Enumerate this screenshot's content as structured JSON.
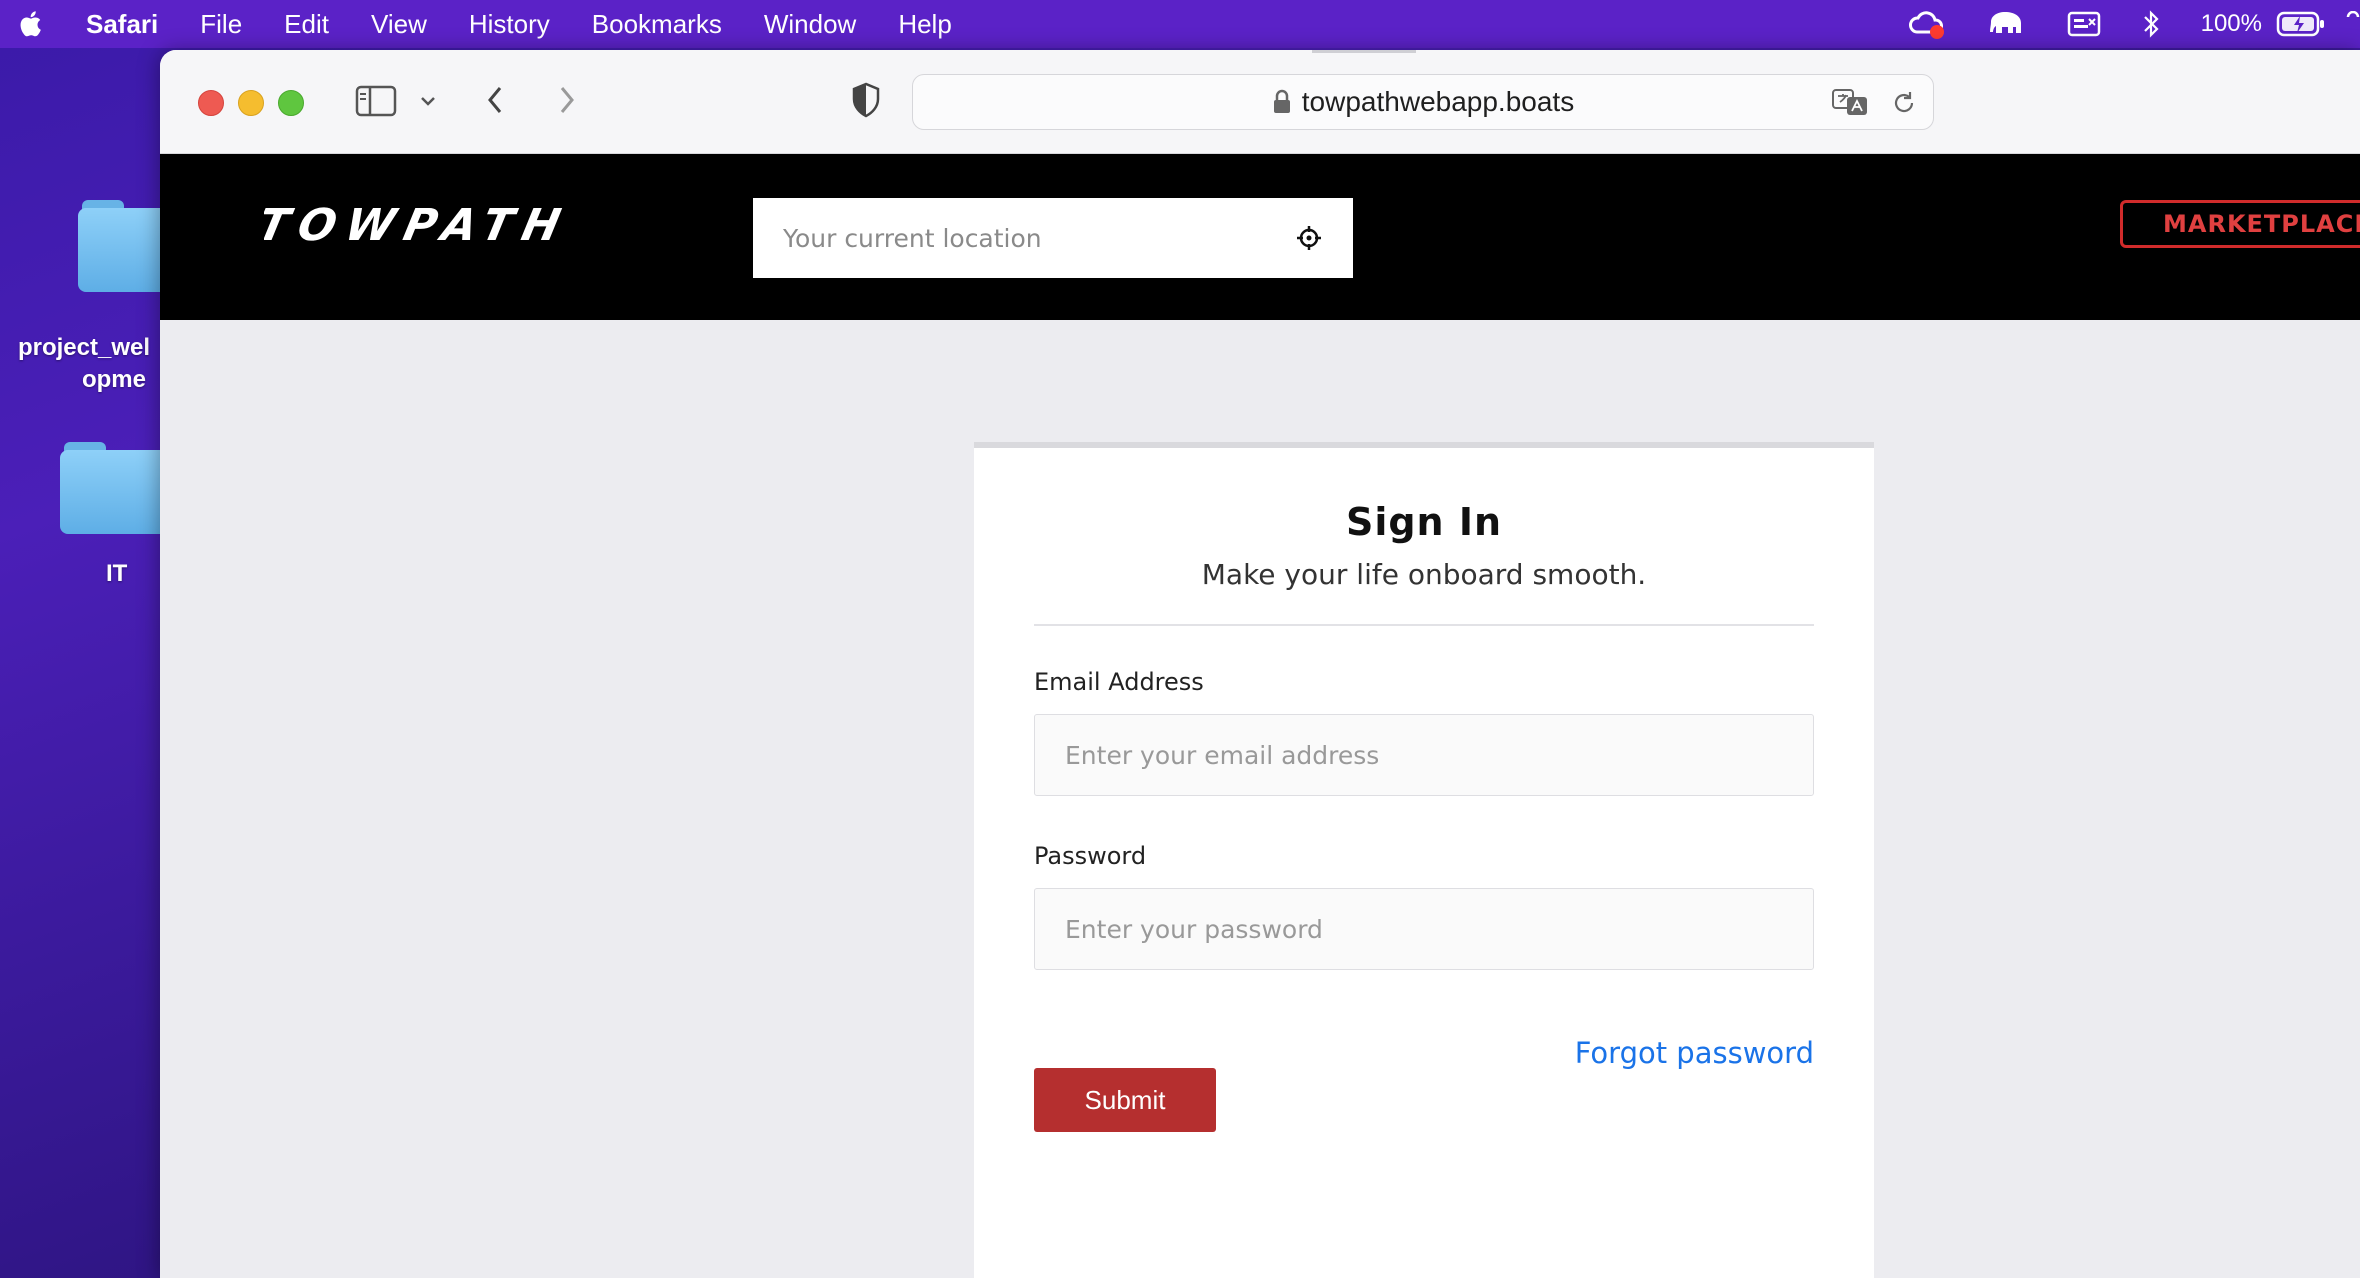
{
  "menubar": {
    "app_name": "Safari",
    "items": [
      "File",
      "Edit",
      "View",
      "History",
      "Bookmarks",
      "Window",
      "Help"
    ],
    "battery_percent": "100%"
  },
  "desktop": {
    "icons": [
      {
        "label": "project_web\nopme"
      },
      {
        "label": "IT"
      }
    ],
    "label_1": "project_wel",
    "label_1b": "opme",
    "label_2": "IT"
  },
  "browser": {
    "url": "towpathwebapp.boats"
  },
  "site": {
    "logo_text": "TOWPATH",
    "location_placeholder": "Your current location",
    "marketplace_label": "MARKETPLACE"
  },
  "signin": {
    "title": "Sign In",
    "subtitle": "Make your life onboard smooth.",
    "email_label": "Email Address",
    "email_placeholder": "Enter your email address",
    "password_label": "Password",
    "password_placeholder": "Enter your password",
    "forgot_label": "Forgot password",
    "submit_label": "Submit"
  },
  "colors": {
    "header_bg": "#000000",
    "accent_red": "#b52f2f",
    "link_blue": "#1a73e8",
    "menubar_bg": "#5b22c7"
  }
}
